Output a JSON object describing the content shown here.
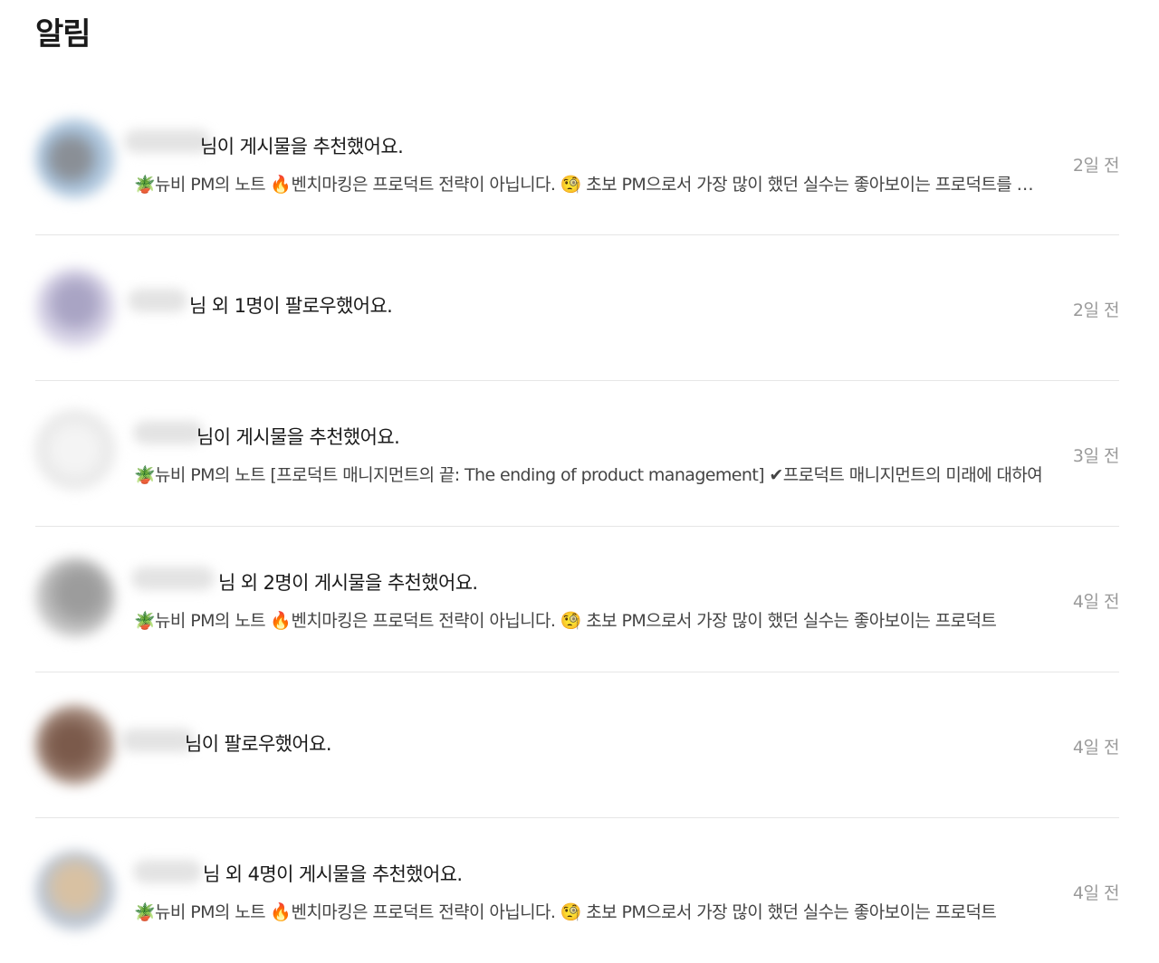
{
  "page": {
    "title": "알림"
  },
  "notifications": [
    {
      "avatar_color": "#9fb6cc",
      "message": "님이 게시물을 추천했어요.",
      "preview": "🪴뉴비 PM의 노트 🔥벤치마킹은 프로덕트 전략이 아닙니다. 🧐 초보 PM으로서 가장 많이 했던 실수는 좋아보이는 프로덕트를 따라하는 것이었습니다",
      "time": "2일 전"
    },
    {
      "avatar_color": "#c9c6dc",
      "message": "님 외 1명이 팔로우했어요.",
      "preview": "",
      "time": "2일 전"
    },
    {
      "avatar_color": "#e8e8e8",
      "message": "님이 게시물을 추천했어요.",
      "preview": "🪴뉴비 PM의 노트 [프로덕트 매니지먼트의 끝: The ending of product management] ✔프로덕트 매니지먼트의 미래에 대하여",
      "time": "3일 전"
    },
    {
      "avatar_color": "#bdbdbd",
      "message": "님 외 2명이 게시물을 추천했어요.",
      "preview": "🪴뉴비 PM의 노트 🔥벤치마킹은 프로덕트 전략이 아닙니다. 🧐 초보 PM으로서 가장 많이 했던 실수는 좋아보이는 프로덕트",
      "time": "4일 전"
    },
    {
      "avatar_color": "#8f7a6e",
      "message": "님이 팔로우했어요.",
      "preview": "",
      "time": "4일 전"
    },
    {
      "avatar_color": "#e3cfb0",
      "message": "님 외 4명이 게시물을 추천했어요.",
      "preview": "🪴뉴비 PM의 노트 🔥벤치마킹은 프로덕트 전략이 아닙니다. 🧐 초보 PM으로서 가장 많이 했던 실수는 좋아보이는 프로덕트",
      "time": "4일 전"
    }
  ]
}
